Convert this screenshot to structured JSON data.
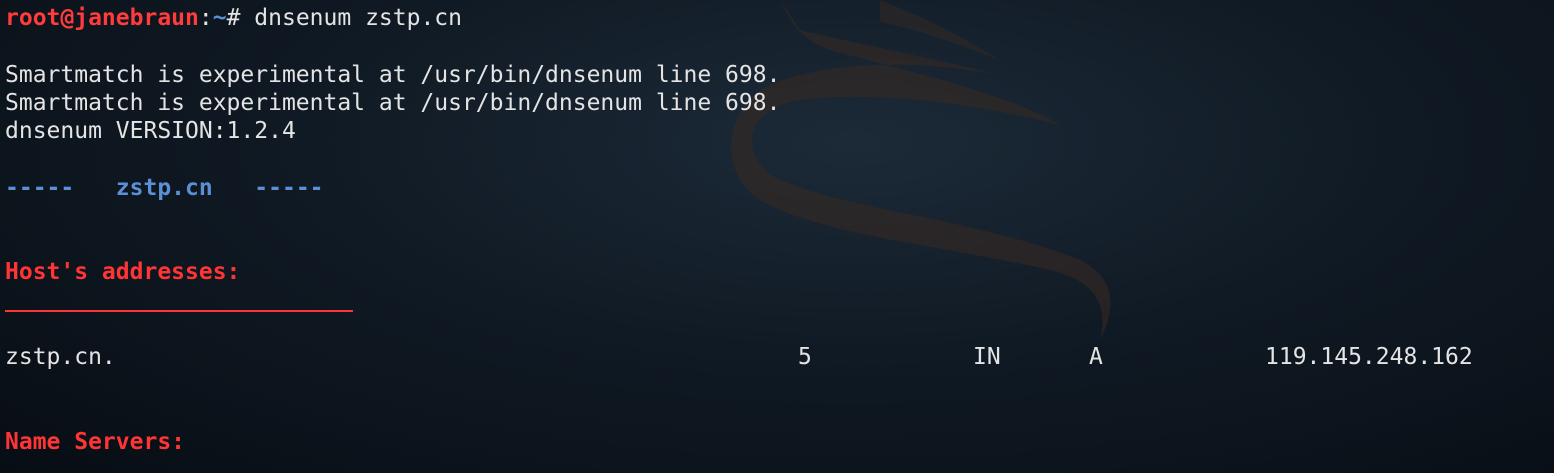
{
  "prompt": {
    "user_host": "root@janebraun",
    "colon": ":",
    "path": "~",
    "symbol": "# ",
    "command": "dnsenum zstp.cn"
  },
  "output": {
    "warning_1": "Smartmatch is experimental at /usr/bin/dnsenum line 698.",
    "warning_2": "Smartmatch is experimental at /usr/bin/dnsenum line 698.",
    "version": "dnsenum VERSION:1.2.4"
  },
  "banner": {
    "left_dashes": "-----",
    "domain": "zstp.cn",
    "right_dashes": "-----"
  },
  "host_addresses": {
    "heading": "Host's addresses:",
    "records": [
      {
        "name": "zstp.cn.",
        "ttl": "5",
        "class": "IN",
        "type": "A",
        "address": "119.145.248.162"
      }
    ]
  },
  "name_servers": {
    "heading": "Name Servers:"
  },
  "colors": {
    "prompt_user": "#ff3b3b",
    "prompt_path": "#5b8fd6",
    "section_heading": "#ff3535",
    "text": "#e4e4e4",
    "background": "#101a24"
  }
}
